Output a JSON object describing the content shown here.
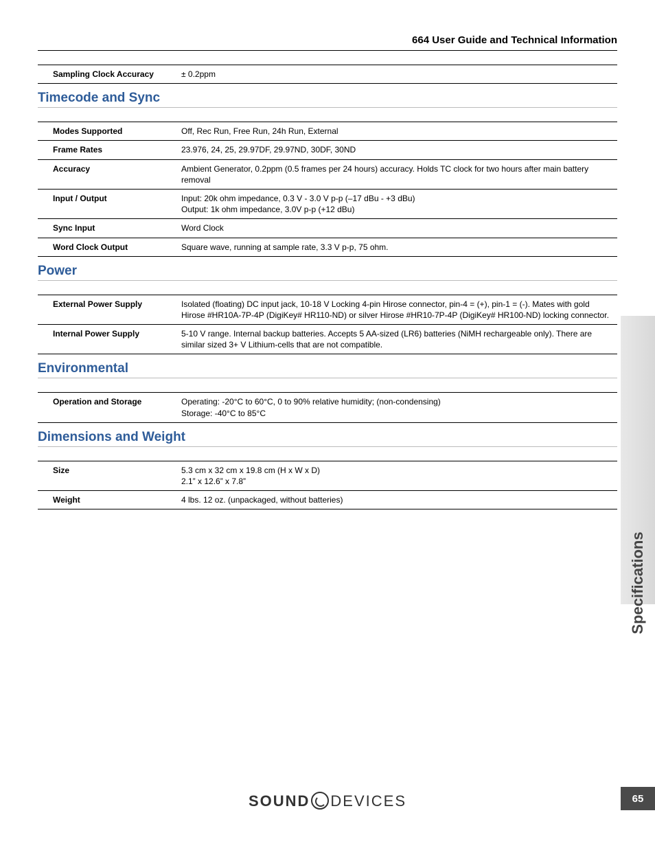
{
  "header": "664 User Guide and Technical Information",
  "top_table": [
    {
      "label": "Sampling Clock Accuracy",
      "value": "± 0.2ppm"
    }
  ],
  "sections": [
    {
      "heading": "Timecode and Sync",
      "rows": [
        {
          "label": "Modes Supported",
          "value": "Off, Rec Run, Free Run, 24h Run, External"
        },
        {
          "label": "Frame Rates",
          "value": "23.976, 24, 25, 29.97DF, 29.97ND, 30DF, 30ND"
        },
        {
          "label": "Accuracy",
          "value": "Ambient Generator, 0.2ppm (0.5 frames per 24 hours) accuracy. Holds TC clock for two hours after main battery removal"
        },
        {
          "label": "Input / Output",
          "value": "Input: 20k ohm impedance, 0.3 V - 3.0 V p-p (–17 dBu - +3 dBu)\nOutput: 1k ohm impedance, 3.0V p-p (+12 dBu)"
        },
        {
          "label": "Sync Input",
          "value": "Word Clock"
        },
        {
          "label": "Word Clock Output",
          "value": "Square wave, running at sample rate, 3.3 V p-p, 75 ohm."
        }
      ]
    },
    {
      "heading": "Power",
      "rows": [
        {
          "label": "External Power Supply",
          "value": "Isolated (floating) DC input jack, 10-18 V Locking 4-pin Hirose connector, pin-4 = (+), pin-1 = (-). Mates with gold Hirose #HR10A-7P-4P (DigiKey# HR110-ND) or silver Hirose #HR10-7P-4P (DigiKey# HR100-ND) locking connector."
        },
        {
          "label": "Internal Power Supply",
          "value": "5-10 V range. Internal backup batteries. Accepts 5 AA-sized (LR6) batteries (NiMH rechargeable only). There are similar sized 3+ V Lithium-cells that are not compatible."
        }
      ]
    },
    {
      "heading": "Environmental",
      "rows": [
        {
          "label": "Operation and Storage",
          "value": "Operating: -20°C to 60°C, 0 to 90% relative humidity; (non-condensing)\nStorage: -40°C to 85°C"
        }
      ]
    },
    {
      "heading": "Dimensions and Weight",
      "rows": [
        {
          "label": "Size",
          "value": "5.3 cm x 32 cm x 19.8 cm (H x W x D)\n2.1” x 12.6” x 7.8”"
        },
        {
          "label": "Weight",
          "value": "4 lbs. 12 oz. (unpackaged, without batteries)"
        }
      ]
    }
  ],
  "side_tab": "Specifications",
  "page_number": "65",
  "logo": {
    "part1": "SOUND",
    "part2": "DEVICES"
  }
}
